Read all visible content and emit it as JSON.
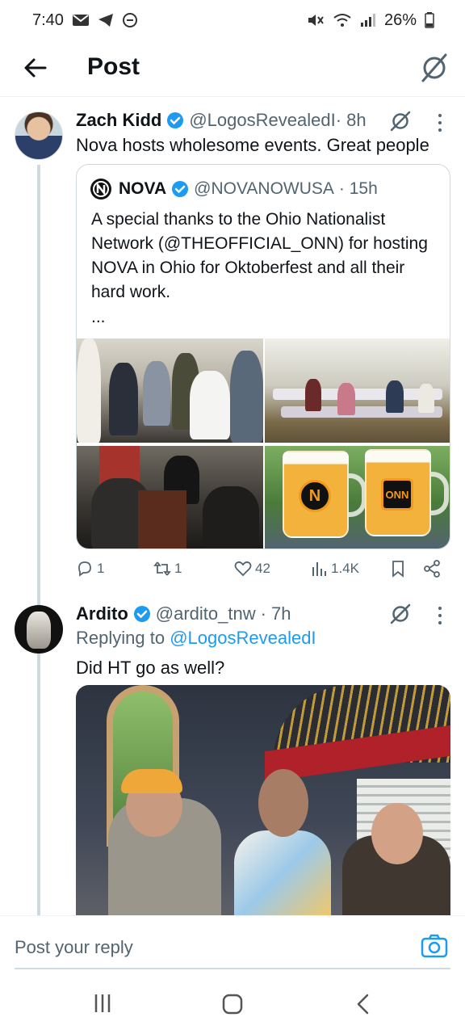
{
  "status_bar": {
    "time": "7:40",
    "battery": "26%"
  },
  "header": {
    "title": "Post"
  },
  "tweet": {
    "name": "Zach Kidd",
    "handle": "@LogosRevealedI",
    "time": "· 8h",
    "text": "Nova hosts wholesome events. Great people",
    "quote": {
      "name": "NOVA",
      "handle": "@NOVANOWUSA",
      "time": "· 15h",
      "text": "A special thanks to the Ohio Nationalist Network (@THEOFFICIAL_ONN) for hosting NOVA in Ohio for Oktoberfest and all their hard work.",
      "more": "...",
      "mug_labels": [
        "N",
        "ONN"
      ]
    },
    "actions": {
      "replies": "1",
      "reposts": "1",
      "likes": "42",
      "views": "1.4K"
    }
  },
  "reply": {
    "name": "Ardito",
    "handle": "@ardito_tnw",
    "time": "· 7h",
    "replying_prefix": "Replying to",
    "replying_to": "@LogosRevealedI",
    "text": "Did HT go as well?"
  },
  "composer": {
    "placeholder": "Post your reply"
  },
  "colors": {
    "accent": "#1d9bf0",
    "verified": "#1d9bf0",
    "secondary_text": "#536471"
  },
  "icons": [
    "back-arrow-icon",
    "grok-icon",
    "more-icon",
    "verified-icon",
    "reply-icon",
    "repost-icon",
    "like-icon",
    "views-icon",
    "bookmark-icon",
    "share-icon",
    "camera-icon",
    "recents-icon",
    "home-icon",
    "back-icon"
  ]
}
